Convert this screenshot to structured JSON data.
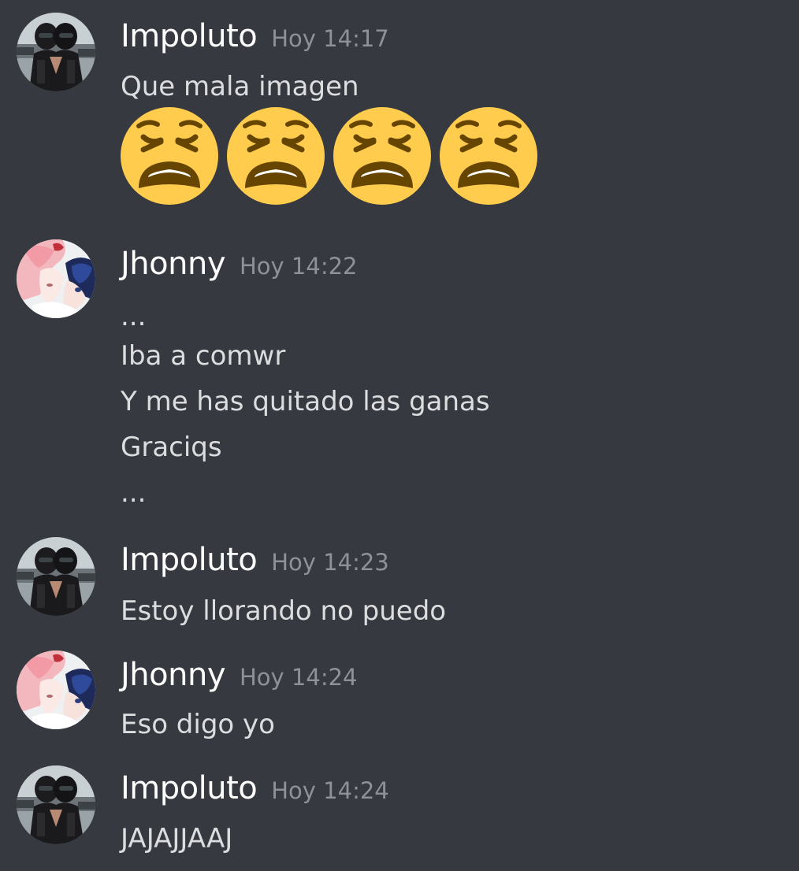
{
  "messages": [
    {
      "author": "Impoluto",
      "timestamp": "Hoy 14:17",
      "avatar": "biker-couple-avatar",
      "lines": [
        "Que mala imagen"
      ],
      "emojis": [
        "weary-face-icon",
        "weary-face-icon",
        "weary-face-icon",
        "weary-face-icon"
      ]
    },
    {
      "author": "Jhonny",
      "timestamp": "Hoy 14:22",
      "avatar": "anime-couple-avatar",
      "lines": [
        "...",
        "Iba a comwr",
        "Y me has quitado las ganas",
        "Graciqs",
        "..."
      ]
    },
    {
      "author": "Impoluto",
      "timestamp": "Hoy 14:23",
      "avatar": "biker-couple-avatar",
      "lines": [
        "Estoy llorando no puedo"
      ]
    },
    {
      "author": "Jhonny",
      "timestamp": "Hoy 14:24",
      "avatar": "anime-couple-avatar",
      "lines": [
        "Eso digo yo"
      ]
    },
    {
      "author": "Impoluto",
      "timestamp": "Hoy 14:24",
      "avatar": "biker-couple-avatar",
      "lines": [
        "JAJAJJAAJ"
      ]
    }
  ],
  "colors": {
    "background": "#36393f",
    "username": "#ffffff",
    "timestamp": "#8e9297",
    "message_text": "#dcddde",
    "emoji_face": "#ffcc4d",
    "emoji_features": "#664500"
  }
}
